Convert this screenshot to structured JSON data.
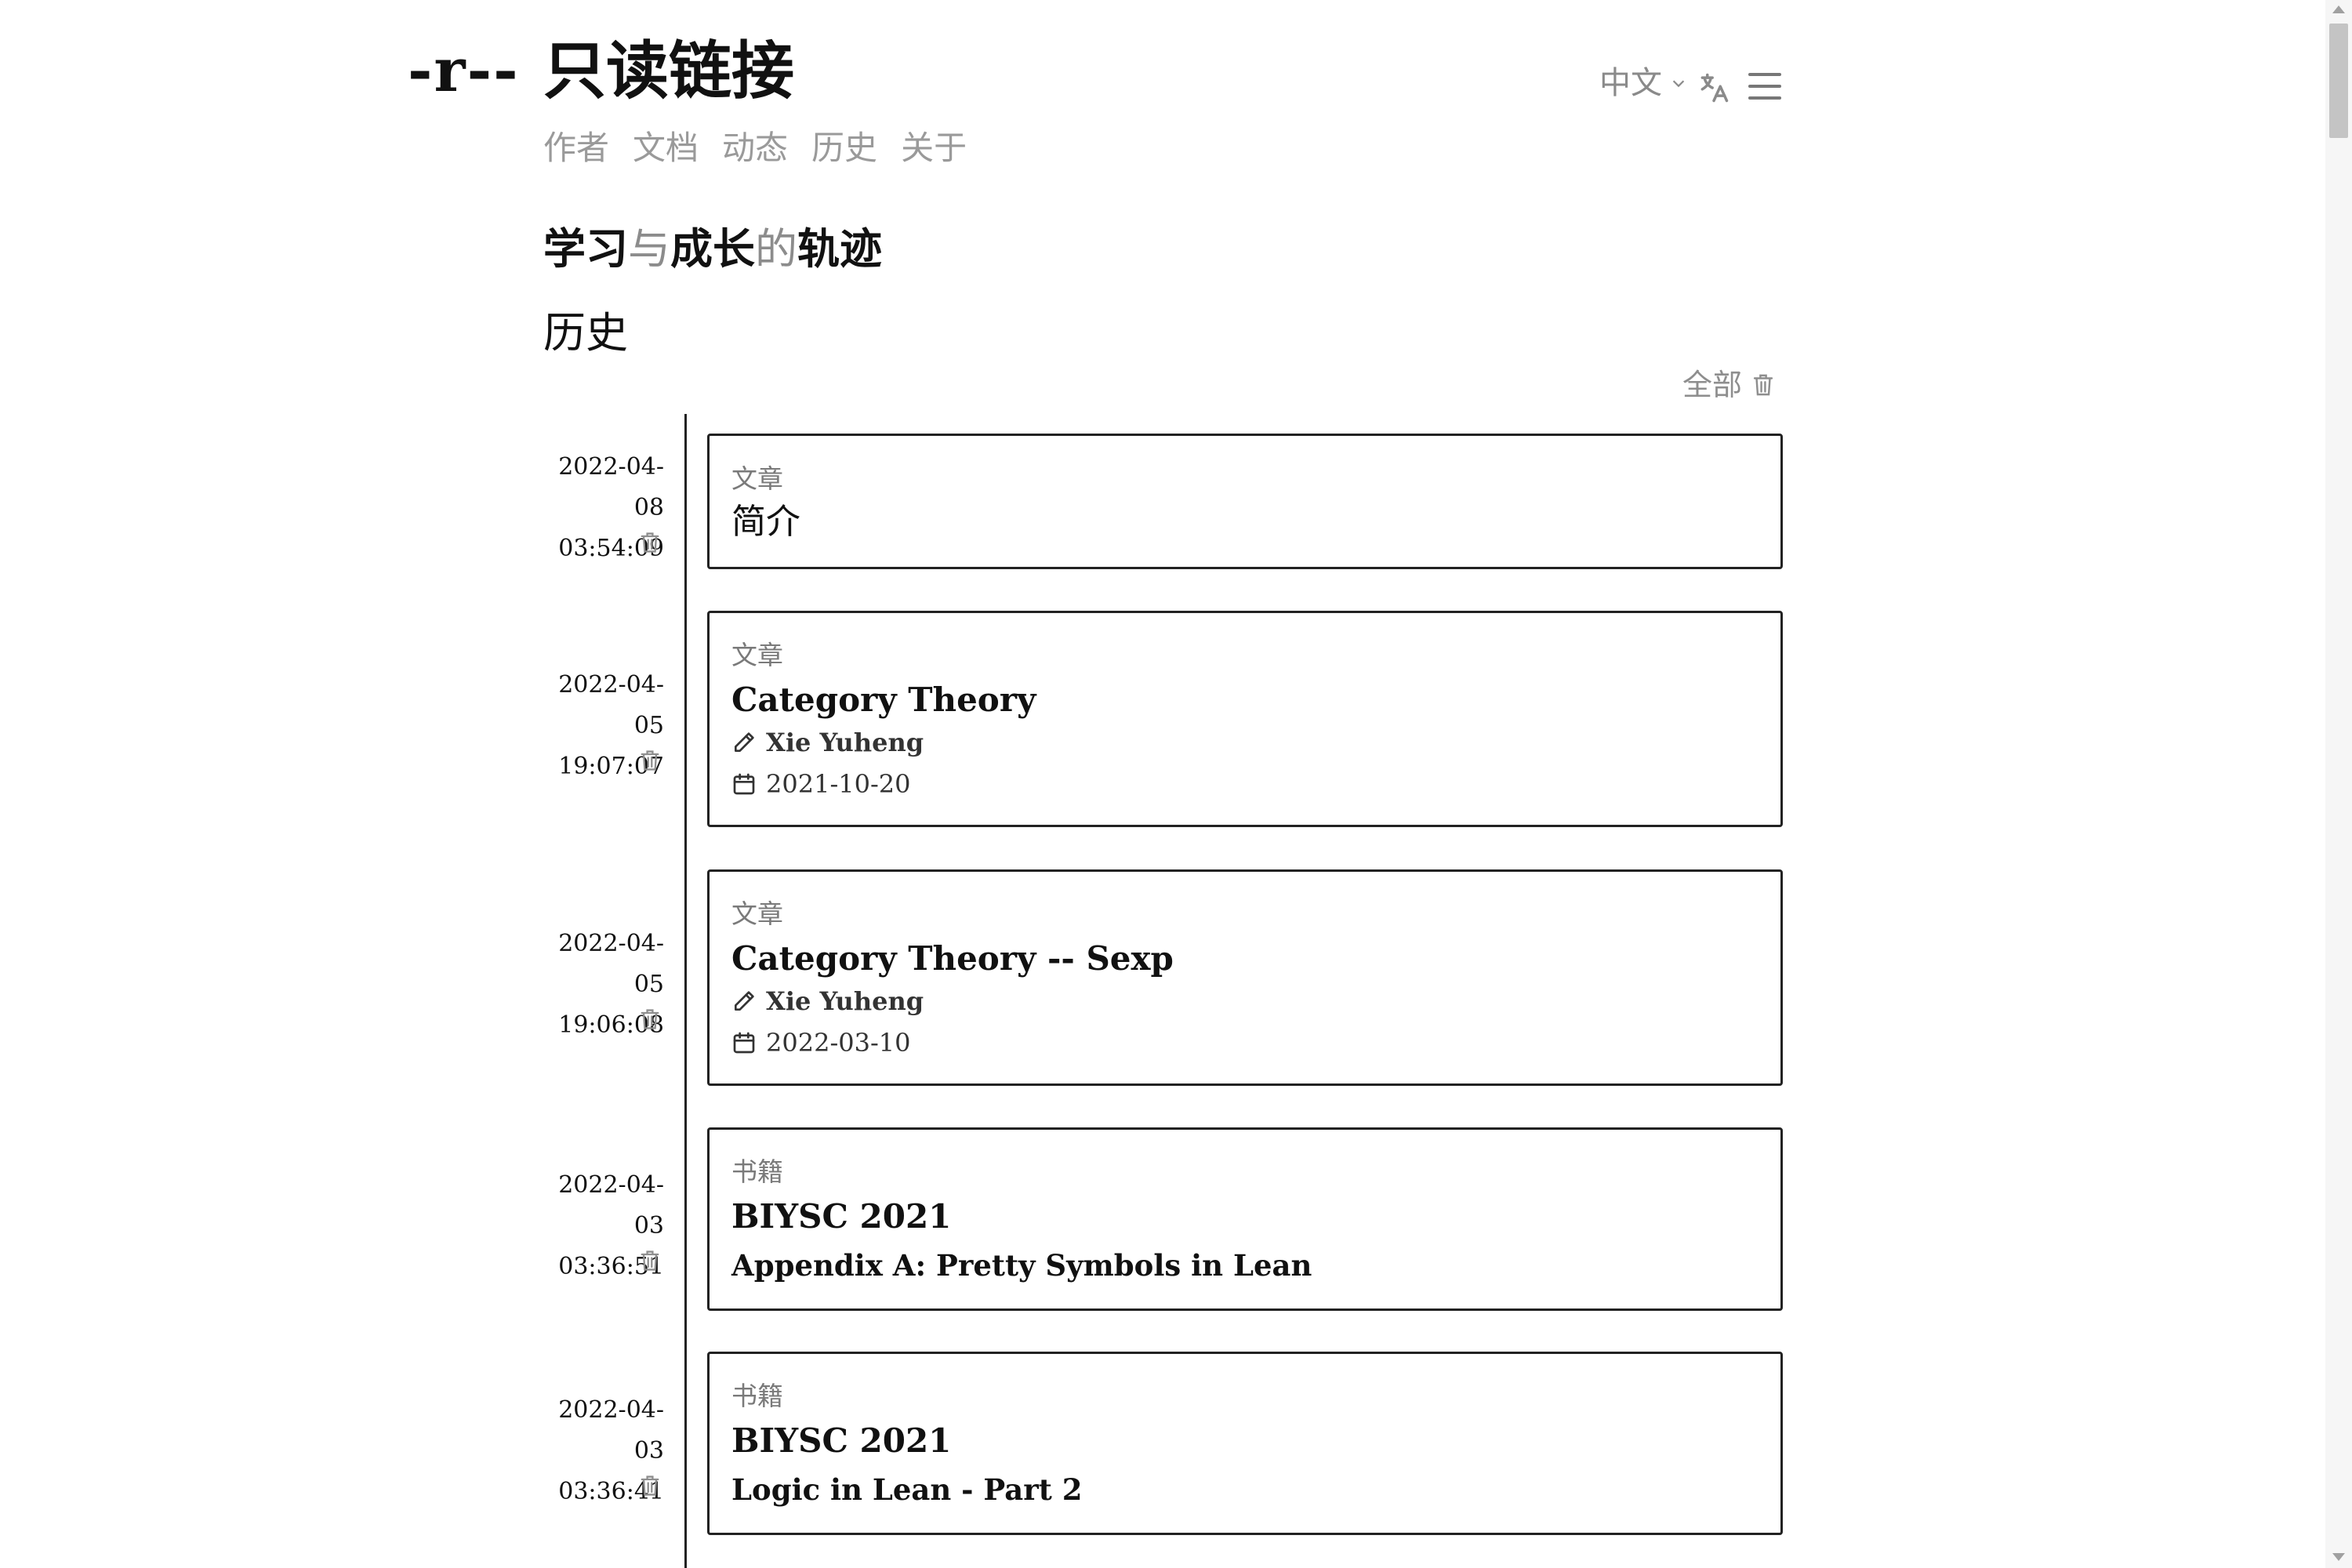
{
  "header": {
    "logo": "-r--",
    "title": "只读链接",
    "nav": [
      "作者",
      "文档",
      "动态",
      "历史",
      "关于"
    ],
    "language": "中文",
    "translate_icon": "translate-icon",
    "menu_icon": "menu-icon"
  },
  "tagline": {
    "parts": [
      "学习",
      "与",
      "成长",
      "的",
      "轨迹"
    ]
  },
  "section": {
    "title": "历史",
    "clear_all_label": "全部",
    "clear_all_icon": "trash-icon"
  },
  "history": [
    {
      "date": "2022-04-08",
      "time": "03:54:09",
      "kind": "文章",
      "title": "简介"
    },
    {
      "date": "2022-04-05",
      "time": "19:07:07",
      "kind": "文章",
      "title": "Category Theory",
      "author": "Xie Yuheng",
      "published": "2021-10-20"
    },
    {
      "date": "2022-04-05",
      "time": "19:06:08",
      "kind": "文章",
      "title": "Category Theory -- Sexp",
      "author": "Xie Yuheng",
      "published": "2022-03-10"
    },
    {
      "date": "2022-04-03",
      "time": "03:36:51",
      "kind": "书籍",
      "title": "BIYSC 2021",
      "subtitle": "Appendix A: Pretty Symbols in Lean"
    },
    {
      "date": "2022-04-03",
      "time": "03:36:41",
      "kind": "书籍",
      "title": "BIYSC 2021",
      "subtitle": "Logic in Lean - Part 2"
    }
  ],
  "colors": {
    "text": "#111111",
    "muted": "#9a9a9a",
    "border": "#222222",
    "background": "#ffffff"
  }
}
